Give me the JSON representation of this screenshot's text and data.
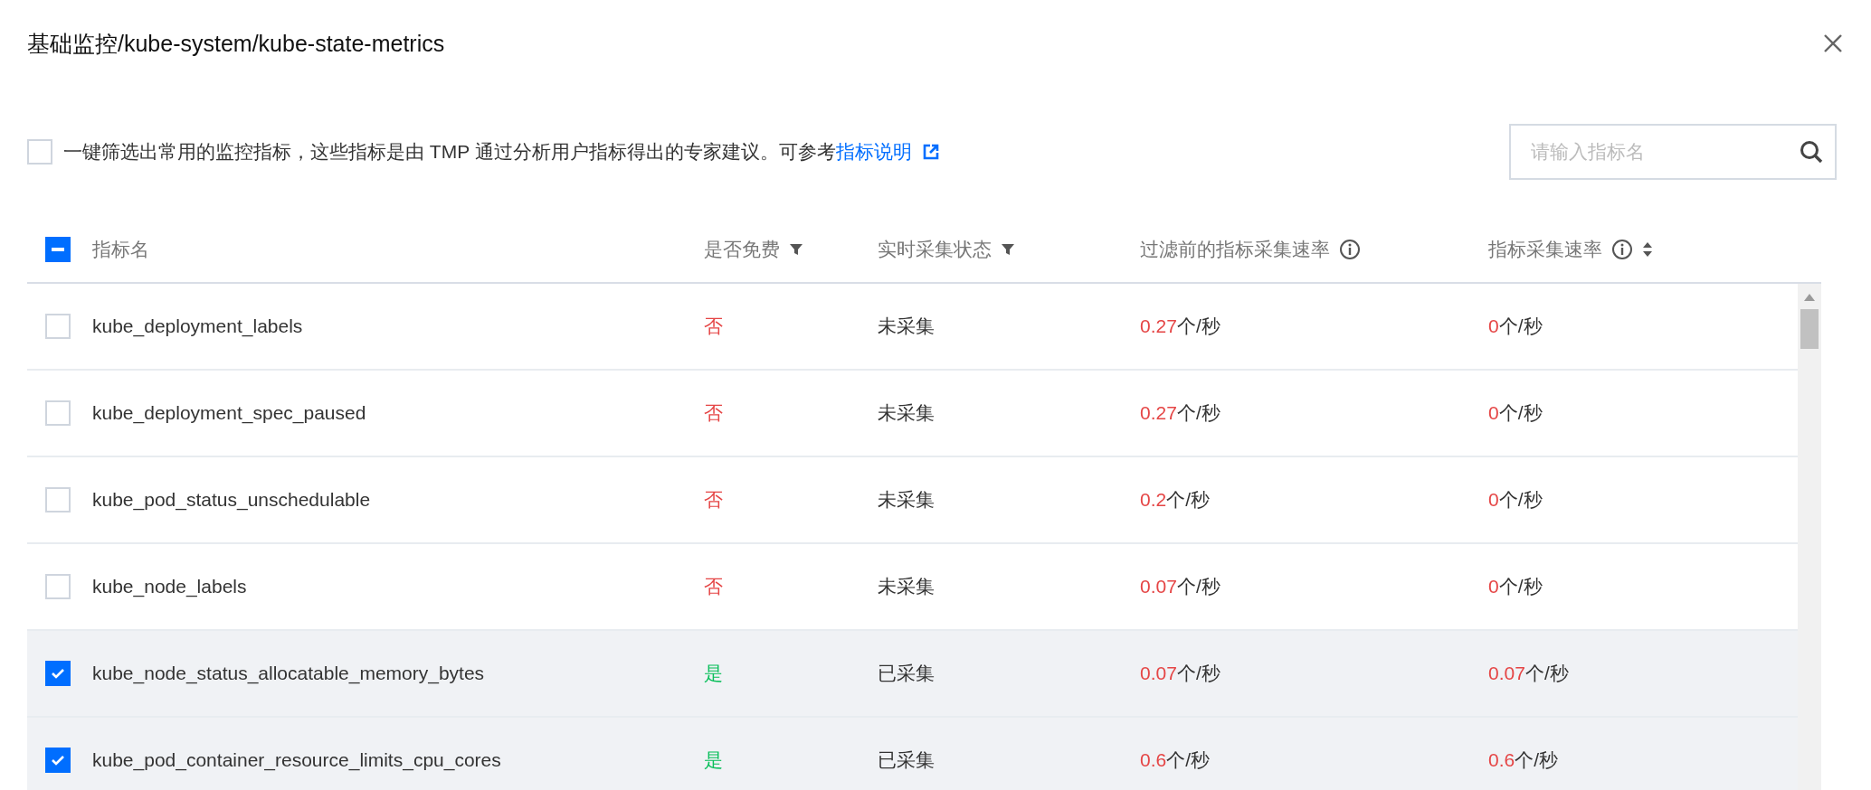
{
  "dialog": {
    "title": "基础监控/kube-system/kube-state-metrics"
  },
  "recommend": {
    "checked": false,
    "text": "一键筛选出常用的监控指标，这些指标是由 TMP 通过分析用户指标得出的专家建议。可参考",
    "link": "指标说明"
  },
  "search": {
    "placeholder": "请输入指标名"
  },
  "table": {
    "select_all": {
      "indeterminate": true
    },
    "columns": [
      {
        "label": "指标名"
      },
      {
        "label": "是否免费",
        "kind": "filter"
      },
      {
        "label": "实时采集状态",
        "kind": "filter"
      },
      {
        "label": "过滤前的指标采集速率",
        "kind": "info"
      },
      {
        "label": "指标采集速率",
        "kind": "sortable"
      }
    ],
    "rows": [
      {
        "checked": false,
        "name": "kube_deployment_labels",
        "free": false,
        "free_label": "否",
        "status": "未采集",
        "rate_before": "0.27",
        "rate_before_unit": "个/秒",
        "rate": "0",
        "rate_unit": "个/秒"
      },
      {
        "checked": false,
        "name": "kube_deployment_spec_paused",
        "free": false,
        "free_label": "否",
        "status": "未采集",
        "rate_before": "0.27",
        "rate_before_unit": "个/秒",
        "rate": "0",
        "rate_unit": "个/秒"
      },
      {
        "checked": false,
        "name": "kube_pod_status_unschedulable",
        "free": false,
        "free_label": "否",
        "status": "未采集",
        "rate_before": "0.2",
        "rate_before_unit": "个/秒",
        "rate": "0",
        "rate_unit": "个/秒"
      },
      {
        "checked": false,
        "name": "kube_node_labels",
        "free": false,
        "free_label": "否",
        "status": "未采集",
        "rate_before": "0.07",
        "rate_before_unit": "个/秒",
        "rate": "0",
        "rate_unit": "个/秒"
      },
      {
        "checked": true,
        "name": "kube_node_status_allocatable_memory_bytes",
        "free": true,
        "free_label": "是",
        "status": "已采集",
        "rate_before": "0.07",
        "rate_before_unit": "个/秒",
        "rate": "0.07",
        "rate_unit": "个/秒"
      },
      {
        "checked": true,
        "name": "kube_pod_container_resource_limits_cpu_cores",
        "free": true,
        "free_label": "是",
        "status": "已采集",
        "rate_before": "0.6",
        "rate_before_unit": "个/秒",
        "rate": "0.6",
        "rate_unit": "个/秒"
      }
    ]
  }
}
